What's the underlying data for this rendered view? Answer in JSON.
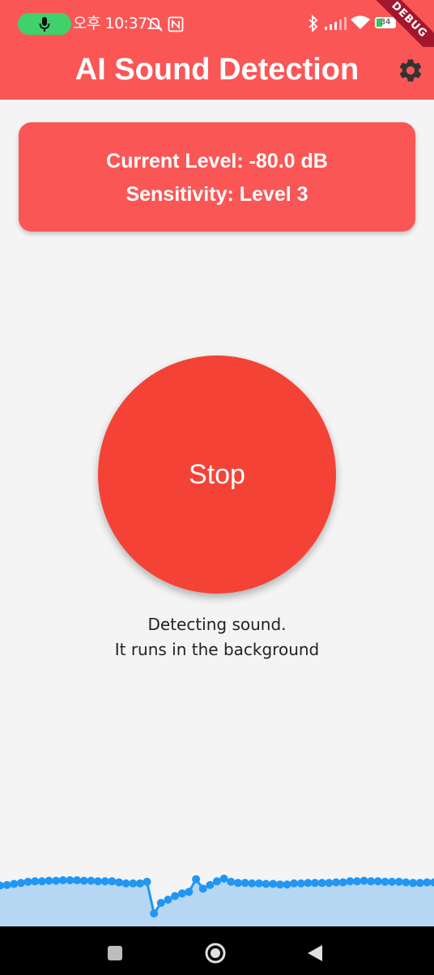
{
  "status_bar": {
    "time": "오후 10:37",
    "battery_level": "34",
    "icons": [
      "mic-icon",
      "mute-icon",
      "nfc-icon",
      "bluetooth-icon",
      "signal-icon",
      "wifi-icon",
      "battery-icon"
    ]
  },
  "debug_banner": "DEBUG",
  "app_bar": {
    "title": "AI Sound Detection",
    "settings_icon": "gear-icon"
  },
  "info_card": {
    "current_level": "Current Level: -80.0 dB",
    "sensitivity": "Sensitivity: Level 3"
  },
  "main": {
    "stop_label": "Stop",
    "status_line1": "Detecting sound.",
    "status_line2": "It runs in the background"
  },
  "colors": {
    "accent": "#fb5656",
    "stop_button": "#f44336",
    "wave_line": "#2196f3",
    "wave_fill": "#b5d7f4"
  },
  "chart_data": {
    "type": "area",
    "values": [
      50,
      51,
      53,
      55,
      57,
      58,
      58,
      59,
      59,
      60,
      60,
      60,
      59,
      59,
      58,
      58,
      58,
      56,
      54,
      54,
      54,
      57,
      -3,
      17,
      23,
      30,
      35,
      38,
      62,
      44,
      51,
      58,
      63,
      57,
      55,
      55,
      54,
      54,
      53,
      53,
      52,
      52,
      54,
      54,
      55,
      55,
      55,
      55,
      56,
      56,
      58,
      58,
      59,
      58,
      58,
      57,
      57,
      57,
      56,
      55,
      55,
      56,
      56
    ]
  }
}
